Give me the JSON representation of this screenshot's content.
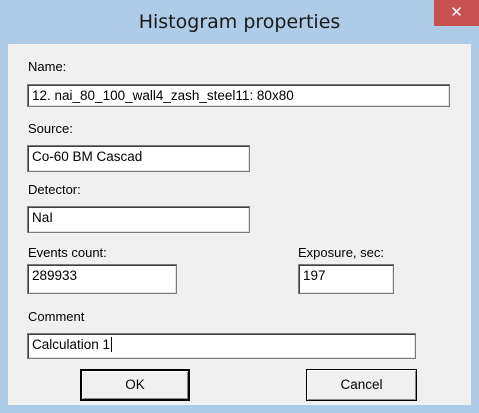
{
  "window": {
    "title": "Histogram properties",
    "close_glyph": "✕"
  },
  "form": {
    "name_label": "Name:",
    "name_value": "12. nai_80_100_wall4_zash_steel11: 80x80",
    "source_label": "Source:",
    "source_value": "Co-60 BM Cascad",
    "detector_label": "Detector:",
    "detector_value": "NaI",
    "events_label": "Events count:",
    "events_value": "289933",
    "exposure_label": "Exposure, sec:",
    "exposure_value": "197",
    "comment_label": "Comment",
    "comment_value": "Calculation 1"
  },
  "buttons": {
    "ok_label": "OK",
    "cancel_label": "Cancel"
  },
  "colors": {
    "titlebar": "#aecbe7",
    "close": "#c75050",
    "client": "#f0f0f0"
  }
}
